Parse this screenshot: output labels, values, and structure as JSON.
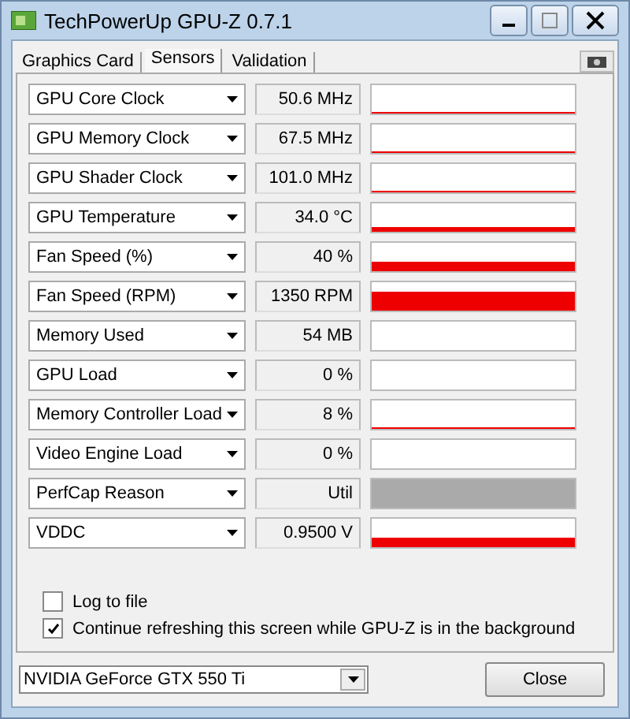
{
  "window": {
    "title": "TechPowerUp GPU-Z 0.7.1"
  },
  "tabs": [
    {
      "label": "Graphics Card",
      "selected": false
    },
    {
      "label": "Sensors",
      "selected": true
    },
    {
      "label": "Validation",
      "selected": false
    }
  ],
  "sensors": [
    {
      "name": "GPU Core Clock",
      "value": "50.6 MHz",
      "kind": "line"
    },
    {
      "name": "GPU Memory Clock",
      "value": "67.5 MHz",
      "kind": "line"
    },
    {
      "name": "GPU Shader Clock",
      "value": "101.0 MHz",
      "kind": "line"
    },
    {
      "name": "GPU Temperature",
      "value": "34.0 °C",
      "kind": "low"
    },
    {
      "name": "Fan Speed (%)",
      "value": "40 %",
      "kind": "mid"
    },
    {
      "name": "Fan Speed (RPM)",
      "value": "1350 RPM",
      "kind": "high"
    },
    {
      "name": "Memory Used",
      "value": "54 MB",
      "kind": "empty"
    },
    {
      "name": "GPU Load",
      "value": "0 %",
      "kind": "empty"
    },
    {
      "name": "Memory Controller Load",
      "value": "8 %",
      "kind": "line"
    },
    {
      "name": "Video Engine Load",
      "value": "0 %",
      "kind": "empty"
    },
    {
      "name": "PerfCap Reason",
      "value": "Util",
      "kind": "status"
    },
    {
      "name": "VDDC",
      "value": "0.9500 V",
      "kind": "mid"
    }
  ],
  "options": [
    {
      "label": "Log to file",
      "checked": false
    },
    {
      "label": "Continue refreshing this screen while GPU-Z is in the background",
      "checked": true
    }
  ],
  "device": {
    "value": "NVIDIA GeForce GTX 550 Ti"
  },
  "close_button": "Close"
}
